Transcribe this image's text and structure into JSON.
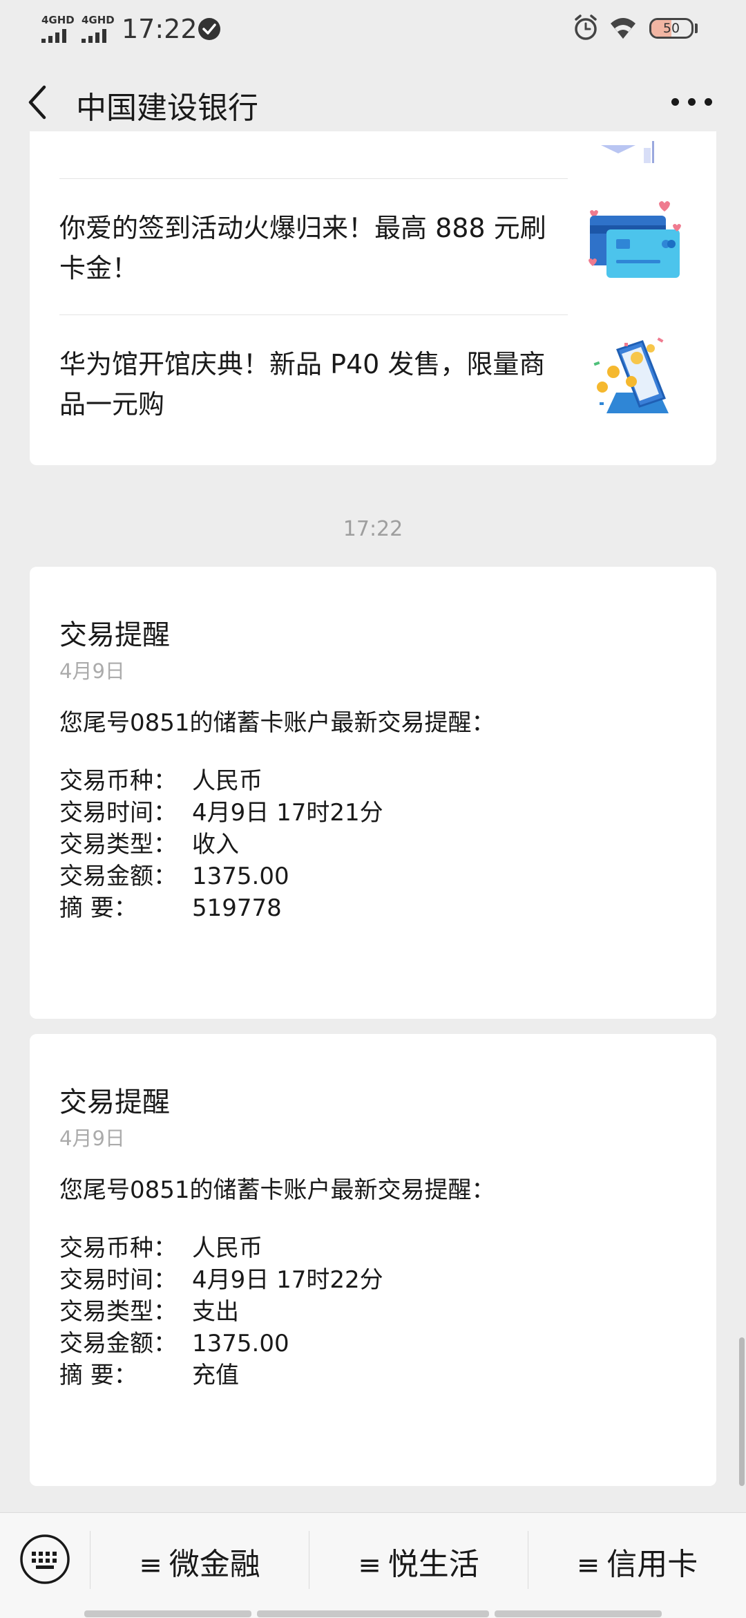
{
  "status_bar": {
    "signal_1": "4GHD",
    "signal_2": "4GHD",
    "time": "17:22",
    "battery": "50",
    "battery_level": 0.5
  },
  "header": {
    "title": "中国建设银行"
  },
  "articles": [
    {
      "text": "你爱的签到活动火爆归来！最高 888 元刷卡金！",
      "thumb_icon": "credit-card-icon"
    },
    {
      "text": "华为馆开馆庆典！新品 P40 发售，限量商品一元购",
      "thumb_icon": "phone-coins-icon"
    }
  ],
  "chat_time": "17:22",
  "transactions": [
    {
      "title": "交易提醒",
      "date": "4月9日",
      "intro": "您尾号0851的储蓄卡账户最新交易提醒：",
      "rows": [
        {
          "label": "交易币种：",
          "value": "人民币"
        },
        {
          "label": "交易时间：",
          "value": "4月9日 17时21分"
        },
        {
          "label": "交易类型：",
          "value": "收入"
        },
        {
          "label": "交易金额：",
          "value": "1375.00"
        },
        {
          "label": "摘        要：",
          "value": "519778"
        }
      ]
    },
    {
      "title": "交易提醒",
      "date": "4月9日",
      "intro": "您尾号0851的储蓄卡账户最新交易提醒：",
      "rows": [
        {
          "label": "交易币种：",
          "value": "人民币"
        },
        {
          "label": "交易时间：",
          "value": "4月9日 17时22分"
        },
        {
          "label": "交易类型：",
          "value": "支出"
        },
        {
          "label": "交易金额：",
          "value": "1375.00"
        },
        {
          "label": "摘        要：",
          "value": "充值"
        }
      ]
    }
  ],
  "bottom_menu": {
    "items": [
      {
        "icon": "≡",
        "label": "微金融"
      },
      {
        "icon": "≡",
        "label": "悦生活"
      },
      {
        "icon": "≡",
        "label": "信用卡"
      }
    ]
  },
  "colors": {
    "background": "#ededed",
    "card": "#ffffff",
    "muted_text": "#9e9e9e",
    "accent_blue": "#2f86d6"
  }
}
